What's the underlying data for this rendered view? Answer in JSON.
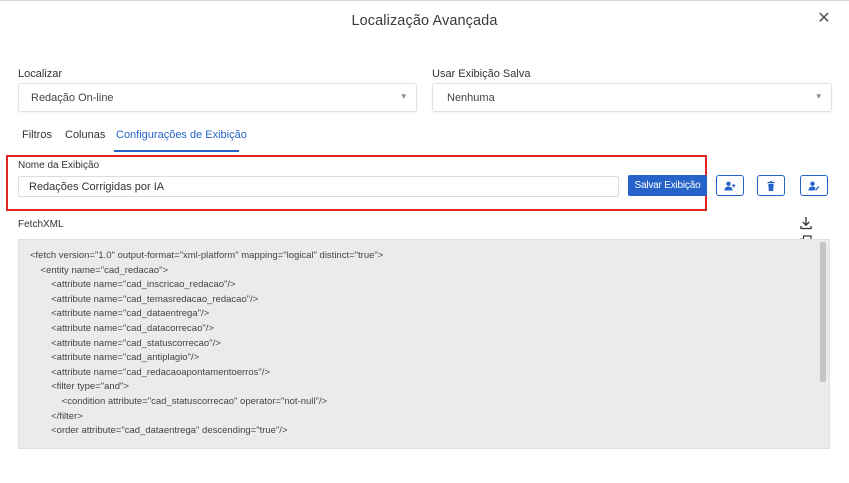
{
  "dialog": {
    "title": "Localização Avançada"
  },
  "find": {
    "label": "Localizar",
    "value": "Redação On-line"
  },
  "saved_view": {
    "label": "Usar Exibição Salva",
    "value": "Nenhuma"
  },
  "tabs": [
    {
      "label": "Filtros"
    },
    {
      "label": "Colunas"
    },
    {
      "label": "Configurações de Exibição"
    }
  ],
  "view_name": {
    "label": "Nome da Exibição",
    "value": "Redações Corrigidas por IA",
    "save_label": "Salvar Exibição"
  },
  "fetchxml": {
    "label": "FetchXML",
    "lines": [
      "<fetch version=\"1.0\" output-format=\"xml-platform\" mapping=\"logical\" distinct=\"true\">",
      "    <entity name=\"cad_redacao\">",
      "        <attribute name=\"cad_inscricao_redacao\"/>",
      "        <attribute name=\"cad_temasredacao_redacao\"/>",
      "        <attribute name=\"cad_dataentrega\"/>",
      "        <attribute name=\"cad_datacorrecao\"/>",
      "        <attribute name=\"cad_statuscorrecao\"/>",
      "        <attribute name=\"cad_antiplagio\"/>",
      "        <attribute name=\"cad_redacaoapontamentoerros\"/>",
      "        <filter type=\"and\">",
      "            <condition attribute=\"cad_statuscorrecao\" operator=\"not-null\"/>",
      "        </filter>",
      "        <order attribute=\"cad_dataentrega\" descending=\"true\"/>"
    ]
  },
  "colors": {
    "accent": "#2563c9",
    "highlight": "#e02424",
    "code_bg": "#ebebeb"
  }
}
